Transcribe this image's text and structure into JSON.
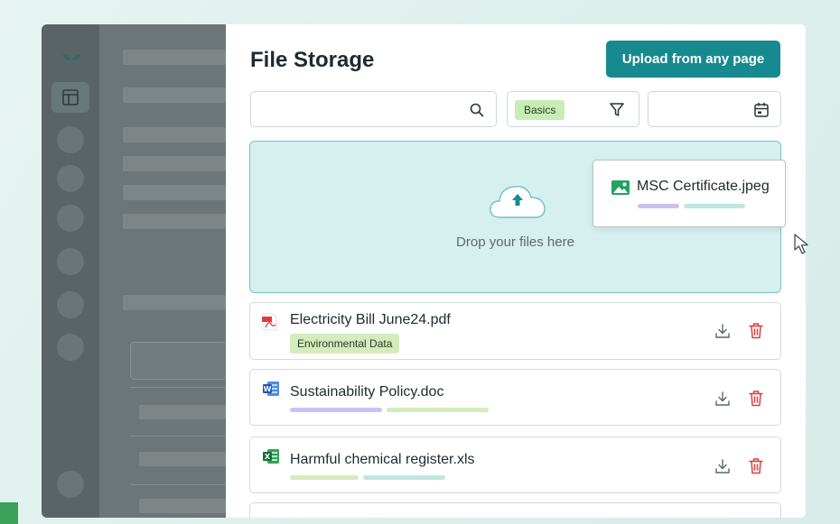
{
  "main": {
    "title": "File Storage",
    "upload_button": "Upload from any page"
  },
  "filters": {
    "chip": "Basics"
  },
  "dropzone": {
    "text": "Drop your files here"
  },
  "dragging_file": {
    "name": "MSC Certificate.jpeg",
    "icon": "image-file-icon"
  },
  "files": [
    {
      "name": "Electricity Bill June24.pdf",
      "icon": "pdf-file-icon",
      "tag": "Environmental Data"
    },
    {
      "name": "Sustainability Policy.doc",
      "icon": "word-file-icon"
    },
    {
      "name": "Harmful chemical register.xls",
      "icon": "excel-file-icon"
    }
  ],
  "colors": {
    "accent": "#168a8f",
    "delete": "#e03c3c",
    "tag_green": "#d4ecbc",
    "pill_purple": "#c7c3f1",
    "pill_teal": "#bfe6e0"
  }
}
